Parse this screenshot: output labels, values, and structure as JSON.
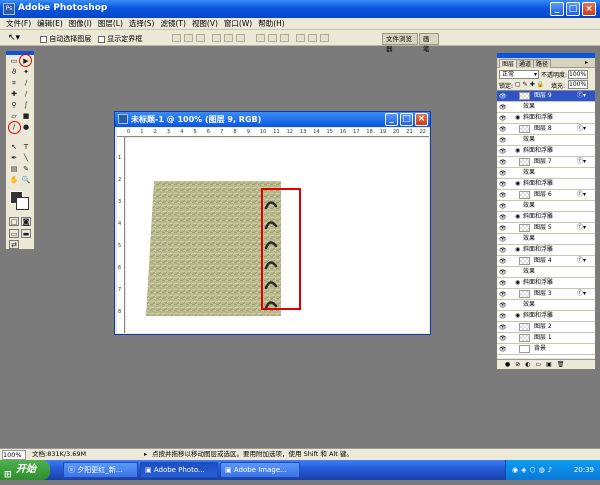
{
  "app": {
    "title": "Adobe Photoshop"
  },
  "menu": [
    "文件(F)",
    "编辑(E)",
    "图像(I)",
    "图层(L)",
    "选择(S)",
    "滤镜(T)",
    "视图(V)",
    "窗口(W)",
    "帮助(H)"
  ],
  "options": {
    "auto_select_label": "自动选择图层",
    "show_bounds_label": "显示定界框",
    "palette_well": [
      "文件浏览器",
      "画笔"
    ]
  },
  "document": {
    "title": "未标题-1 @ 100% (图层 9, RGB)",
    "ruler_h": [
      "0",
      "1",
      "2",
      "3",
      "4",
      "5",
      "6",
      "7",
      "8",
      "9",
      "10",
      "11",
      "12",
      "13",
      "14",
      "15",
      "16",
      "17",
      "18",
      "19",
      "20",
      "21",
      "22"
    ],
    "ruler_v": [
      "1",
      "2",
      "3",
      "4",
      "5",
      "6",
      "7",
      "8"
    ]
  },
  "layers_panel": {
    "tabs": [
      "图层",
      "通道",
      "路径"
    ],
    "blend_mode": "正常",
    "opacity_label": "不透明度:",
    "opacity_value": "100%",
    "lock_label": "锁定:",
    "fill_label": "填充:",
    "fill_value": "100%",
    "rows": [
      {
        "kind": "layer",
        "name": "图层 9",
        "fx": true,
        "selected": true
      },
      {
        "kind": "sub",
        "name": "效果"
      },
      {
        "kind": "sub",
        "name": "斜面和浮雕"
      },
      {
        "kind": "layer",
        "name": "图层 8",
        "fx": true
      },
      {
        "kind": "sub",
        "name": "效果"
      },
      {
        "kind": "sub",
        "name": "斜面和浮雕"
      },
      {
        "kind": "layer",
        "name": "图层 7",
        "fx": true
      },
      {
        "kind": "sub",
        "name": "效果"
      },
      {
        "kind": "sub",
        "name": "斜面和浮雕"
      },
      {
        "kind": "layer",
        "name": "图层 6",
        "fx": true
      },
      {
        "kind": "sub",
        "name": "效果"
      },
      {
        "kind": "sub",
        "name": "斜面和浮雕"
      },
      {
        "kind": "layer",
        "name": "图层 5",
        "fx": true
      },
      {
        "kind": "sub",
        "name": "效果"
      },
      {
        "kind": "sub",
        "name": "斜面和浮雕"
      },
      {
        "kind": "layer",
        "name": "图层 4",
        "fx": true
      },
      {
        "kind": "sub",
        "name": "效果"
      },
      {
        "kind": "sub",
        "name": "斜面和浮雕"
      },
      {
        "kind": "layer",
        "name": "图层 3",
        "fx": true
      },
      {
        "kind": "sub",
        "name": "效果"
      },
      {
        "kind": "sub",
        "name": "斜面和浮雕"
      },
      {
        "kind": "layer",
        "name": "图层 2"
      },
      {
        "kind": "layer",
        "name": "图层 1"
      },
      {
        "kind": "layer",
        "name": "背景"
      }
    ]
  },
  "statusbar": {
    "zoom": "100%",
    "doc_size": "文档:831K/3.69M",
    "hint": "点按并拖移以移动图层或选区。要用附加选项，使用 Shift 和 Alt 键。"
  },
  "taskbar": {
    "start": "开始",
    "tasks": [
      "夕阳更红_新...",
      "Adobe Photo...",
      "Adobe Image..."
    ],
    "clock": "20:39"
  },
  "colors": {
    "xp_blue": "#0a55e0",
    "annotation_red": "#e00000",
    "paper": "#b9b98a"
  }
}
